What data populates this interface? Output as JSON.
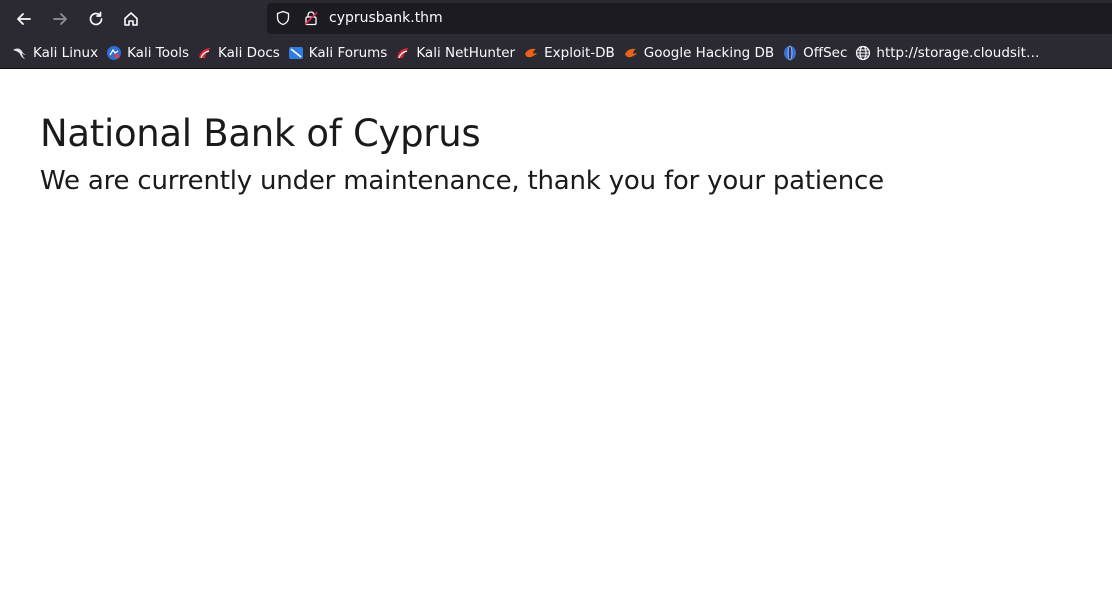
{
  "browser": {
    "url": "cyprusbank.thm",
    "nav": {
      "back_icon": "arrow-left-icon",
      "forward_icon": "arrow-right-icon",
      "reload_icon": "reload-icon",
      "home_icon": "home-icon"
    }
  },
  "bookmarks": [
    {
      "label": "Kali Linux",
      "icon": "kali-dragon-icon"
    },
    {
      "label": "Kali Tools",
      "icon": "kali-tools-icon"
    },
    {
      "label": "Kali Docs",
      "icon": "kali-red-icon"
    },
    {
      "label": "Kali Forums",
      "icon": "kali-forums-icon"
    },
    {
      "label": "Kali NetHunter",
      "icon": "kali-red-icon"
    },
    {
      "label": "Exploit-DB",
      "icon": "exploit-db-icon"
    },
    {
      "label": "Google Hacking DB",
      "icon": "exploit-db-icon"
    },
    {
      "label": "OffSec",
      "icon": "offsec-icon"
    },
    {
      "label": "http://storage.cloudsit…",
      "icon": "globe-icon"
    }
  ],
  "page": {
    "heading": "National Bank of Cyprus",
    "subheading": "We are currently under maintenance, thank you for your patience"
  },
  "colors": {
    "toolbar_bg": "#2b2a33",
    "urlbar_bg": "#1c1b22",
    "text_light": "#fbfbfe",
    "page_bg": "#ffffff"
  }
}
